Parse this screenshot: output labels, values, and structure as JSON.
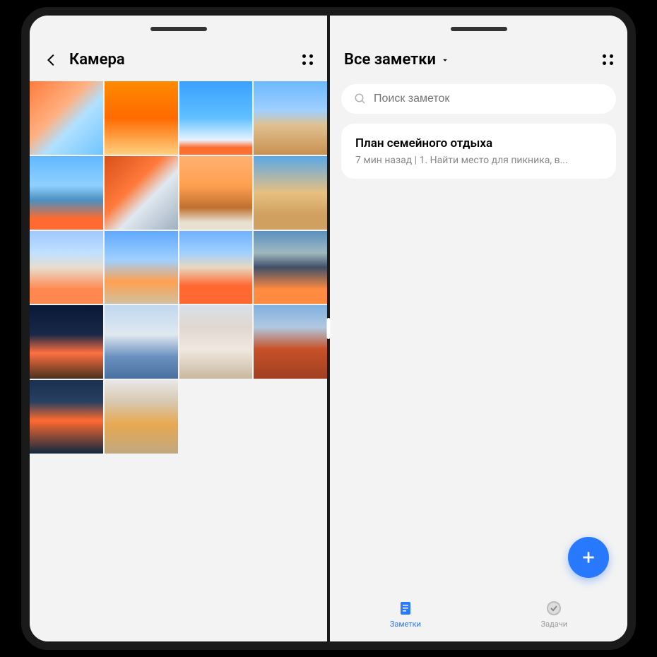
{
  "gallery": {
    "title": "Камера",
    "thumbs": [
      {
        "bg": "linear-gradient(135deg,#ff7a3c 0%,#ffb080 40%,#b0e0ff 60%,#6fc5ff 100%)"
      },
      {
        "bg": "linear-gradient(180deg,#ff8a00 0%,#ff6a00 50%,#ffd080 100%)"
      },
      {
        "bg": "linear-gradient(180deg,#3aa0ff 0%,#60c0ff 50%,#e8f4ff 80%,#ff7030 90%)"
      },
      {
        "bg": "linear-gradient(180deg,#6bb8ff 0%,#a0d0ff 40%,#e0c090 60%,#c89050 100%)"
      },
      {
        "bg": "linear-gradient(180deg,#60b8ff 0%,#90d0ff 40%,#4a90c0 60%,#ff6a30 85%)"
      },
      {
        "bg": "linear-gradient(135deg,#d85018 0%,#ff7a3c 40%,#e0e8f0 60%,#a0b0c0 100%)"
      },
      {
        "bg": "linear-gradient(180deg,#ffb070 0%,#ffa050 40%,#c07030 70%,#e8e0d0 90%)"
      },
      {
        "bg": "linear-gradient(180deg,#5aa8e8 0%,#e8c080 50%,#d0a060 80%)"
      },
      {
        "bg": "linear-gradient(180deg,#a0c8ff 0%,#c0e0ff 30%,#e8ddd0 50%,#ff8850 80%)"
      },
      {
        "bg": "linear-gradient(180deg,#60a8ff 0%,#a0d0ff 40%,#ffa050 70%,#d0c0a0 100%)"
      },
      {
        "bg": "linear-gradient(180deg,#70b0ff 0%,#a0d0ff 30%,#e8d8c0 50%,#ff6830 75%)"
      },
      {
        "bg": "linear-gradient(180deg,#5a90c0 0%,#a0b8c0 30%,#405068 50%,#ff8a40 80%)"
      },
      {
        "bg": "linear-gradient(180deg,#0a1838 0%,#1a2848 40%,#ff7040 65%,#4a3020 100%)"
      },
      {
        "bg": "linear-gradient(180deg,#c0d8f0 0%,#e0e8f0 40%,#6a90c0 70%,#4a70a0 100%)"
      },
      {
        "bg": "linear-gradient(180deg,#d8e0e8 0%,#e0d8d0 30%,#f0e8e0 60%,#c8b8a0 100%)"
      },
      {
        "bg": "linear-gradient(180deg,#80b0e0 0%,#b0c8e0 30%,#c85028 60%,#a04020 100%)"
      },
      {
        "bg": "linear-gradient(180deg,#1a3050 0%,#2a4060 30%,#ff6a30 55%,#102840 100%)"
      },
      {
        "bg": "linear-gradient(180deg,#e8e8e8 0%,#d8c8b0 30%,#e8a850 60%,#c0a880 100%)"
      }
    ]
  },
  "notes": {
    "title": "Все заметки",
    "search_placeholder": "Поиск заметок",
    "items": [
      {
        "title": "План семейного отдыха",
        "meta": "7 мин назад  |  1. Найти место для пикника, в..."
      }
    ],
    "tabs": {
      "notes": "Заметки",
      "tasks": "Задачи"
    }
  }
}
